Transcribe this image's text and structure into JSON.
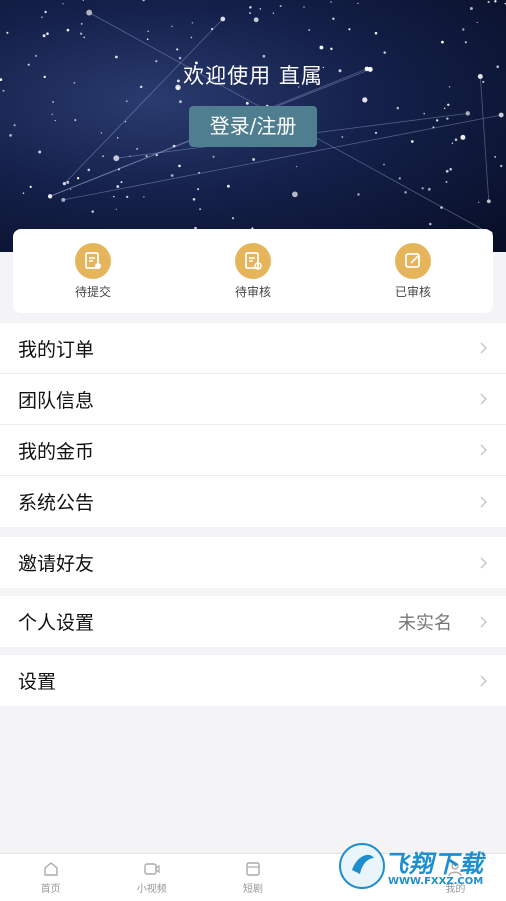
{
  "hero": {
    "welcome_text": "欢迎使用 直属",
    "login_label": "登录/注册"
  },
  "status": [
    {
      "label": "待提交",
      "icon": "document-submit-icon"
    },
    {
      "label": "待审核",
      "icon": "document-review-icon"
    },
    {
      "label": "已审核",
      "icon": "edit-done-icon"
    }
  ],
  "menu": {
    "group1": [
      "我的订单",
      "团队信息",
      "我的金币",
      "系统公告"
    ],
    "invite": "邀请好友",
    "profile_label": "个人设置",
    "profile_value": "未实名",
    "settings": "设置"
  },
  "tabbar": [
    "首页",
    "小视频",
    "短剧",
    "",
    "我的"
  ],
  "watermark": {
    "text": "飞翔下载",
    "url": "WWW.FXXZ.COM"
  },
  "colors": {
    "accent_icon": "#e6b45a",
    "login_button": "#4e7e8f",
    "hero_bg": "#14204a"
  }
}
